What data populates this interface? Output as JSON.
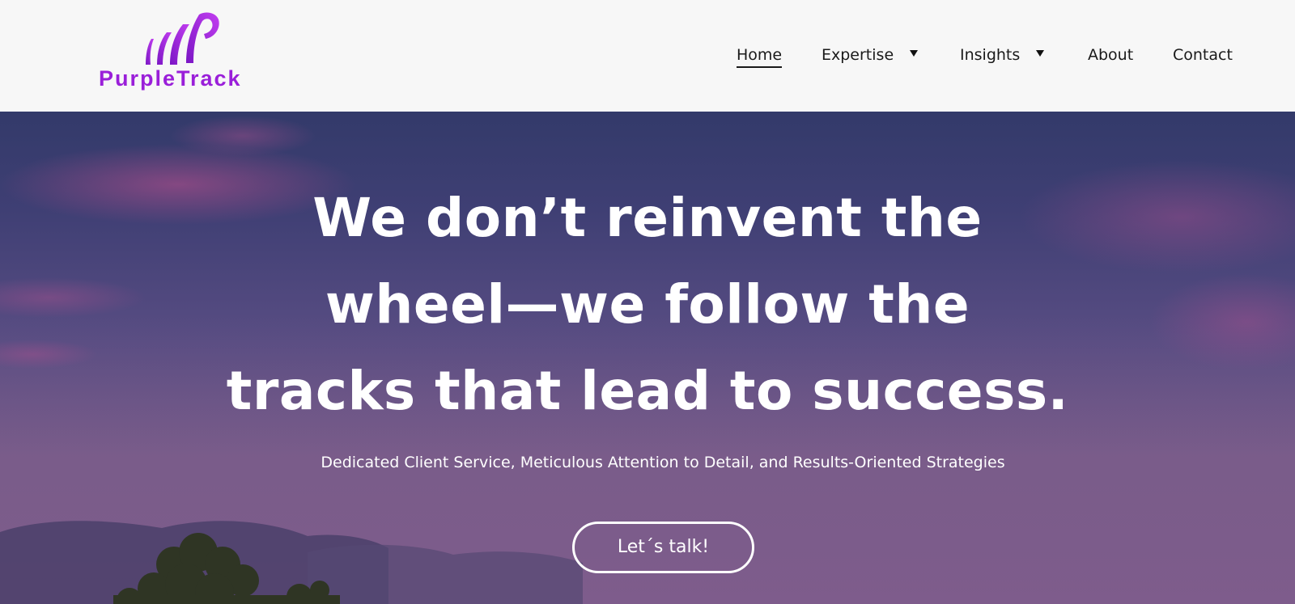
{
  "brand": {
    "name": "PurpleTrack",
    "logo_icon": "purpletrack-logo-icon",
    "color": "#9a1fd9"
  },
  "nav": {
    "items": [
      {
        "label": "Home",
        "active": true,
        "has_dropdown": false
      },
      {
        "label": "Expertise",
        "active": false,
        "has_dropdown": true
      },
      {
        "label": "Insights",
        "active": false,
        "has_dropdown": true
      },
      {
        "label": "About",
        "active": false,
        "has_dropdown": false
      },
      {
        "label": "Contact",
        "active": false,
        "has_dropdown": false
      }
    ],
    "dropdown_icon": "caret-down-icon"
  },
  "hero": {
    "headline": {
      "lines": [
        "We don’t reinvent the",
        "wheel—we follow the",
        "tracks that lead to success."
      ]
    },
    "subtitle": "Dedicated Client Service, Meticulous Attention to Detail, and Results-Oriented Strategies",
    "cta_label": "Let´s talk!",
    "background": "purple-sunset-sky-photo"
  },
  "colors": {
    "header_bg": "#f7f7f7",
    "hero_top": "#333a6a",
    "hero_bottom": "#735987",
    "text_light": "#ffffff",
    "nav_text": "#1a1a1a"
  }
}
